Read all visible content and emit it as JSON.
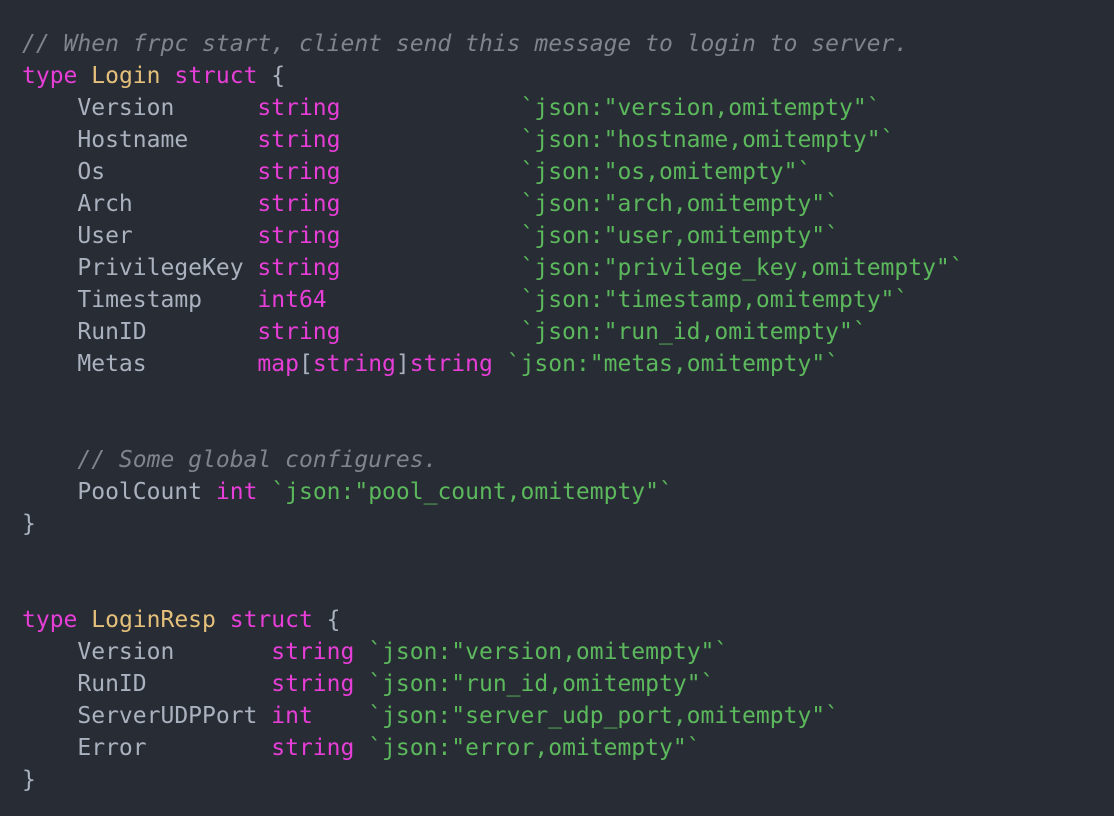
{
  "editor": {
    "language": "go",
    "background_color": "#282c34",
    "theme_colors": {
      "comment": "#7f848e",
      "keyword": "#e83ed8",
      "type_name": "#e5c07b",
      "builtin_type": "#e83ed8",
      "identifier": "#abb2bf",
      "punctuation": "#abb2bf",
      "struct_tag": "#5cb85c"
    }
  },
  "lines": [
    {
      "n": 1,
      "tokens": [
        {
          "t": "// When frpc start, client send this message to login to server.",
          "c": "comment"
        }
      ]
    },
    {
      "n": 2,
      "tokens": [
        {
          "t": "type ",
          "c": "keyword"
        },
        {
          "t": "Login",
          "c": "typename"
        },
        {
          "t": " ",
          "c": "plain"
        },
        {
          "t": "struct",
          "c": "keyword"
        },
        {
          "t": " {",
          "c": "punct"
        }
      ]
    },
    {
      "n": 3,
      "tokens": [
        {
          "t": "    Version      ",
          "c": "ident"
        },
        {
          "t": "string",
          "c": "type"
        },
        {
          "t": "             ",
          "c": "plain"
        },
        {
          "t": "`json:\"version,omitempty\"`",
          "c": "tag"
        }
      ]
    },
    {
      "n": 4,
      "tokens": [
        {
          "t": "    Hostname     ",
          "c": "ident"
        },
        {
          "t": "string",
          "c": "type"
        },
        {
          "t": "             ",
          "c": "plain"
        },
        {
          "t": "`json:\"hostname,omitempty\"`",
          "c": "tag"
        }
      ]
    },
    {
      "n": 5,
      "tokens": [
        {
          "t": "    Os           ",
          "c": "ident"
        },
        {
          "t": "string",
          "c": "type"
        },
        {
          "t": "             ",
          "c": "plain"
        },
        {
          "t": "`json:\"os,omitempty\"`",
          "c": "tag"
        }
      ]
    },
    {
      "n": 6,
      "tokens": [
        {
          "t": "    Arch         ",
          "c": "ident"
        },
        {
          "t": "string",
          "c": "type"
        },
        {
          "t": "             ",
          "c": "plain"
        },
        {
          "t": "`json:\"arch,omitempty\"`",
          "c": "tag"
        }
      ]
    },
    {
      "n": 7,
      "tokens": [
        {
          "t": "    User         ",
          "c": "ident"
        },
        {
          "t": "string",
          "c": "type"
        },
        {
          "t": "             ",
          "c": "plain"
        },
        {
          "t": "`json:\"user,omitempty\"`",
          "c": "tag"
        }
      ]
    },
    {
      "n": 8,
      "tokens": [
        {
          "t": "    PrivilegeKey ",
          "c": "ident"
        },
        {
          "t": "string",
          "c": "type"
        },
        {
          "t": "             ",
          "c": "plain"
        },
        {
          "t": "`json:\"privilege_key,omitempty\"`",
          "c": "tag"
        }
      ]
    },
    {
      "n": 9,
      "tokens": [
        {
          "t": "    Timestamp    ",
          "c": "ident"
        },
        {
          "t": "int64",
          "c": "type"
        },
        {
          "t": "              ",
          "c": "plain"
        },
        {
          "t": "`json:\"timestamp,omitempty\"`",
          "c": "tag"
        }
      ]
    },
    {
      "n": 10,
      "tokens": [
        {
          "t": "    RunID        ",
          "c": "ident"
        },
        {
          "t": "string",
          "c": "type"
        },
        {
          "t": "             ",
          "c": "plain"
        },
        {
          "t": "`json:\"run_id,omitempty\"`",
          "c": "tag"
        }
      ]
    },
    {
      "n": 11,
      "tokens": [
        {
          "t": "    Metas        ",
          "c": "ident"
        },
        {
          "t": "map",
          "c": "type"
        },
        {
          "t": "[",
          "c": "punct"
        },
        {
          "t": "string",
          "c": "type"
        },
        {
          "t": "]",
          "c": "punct"
        },
        {
          "t": "string",
          "c": "type"
        },
        {
          "t": " ",
          "c": "plain"
        },
        {
          "t": "`json:\"metas,omitempty\"`",
          "c": "tag"
        }
      ]
    },
    {
      "n": 12,
      "tokens": []
    },
    {
      "n": 13,
      "tokens": []
    },
    {
      "n": 14,
      "tokens": [
        {
          "t": "    // Some global configures.",
          "c": "comment"
        }
      ]
    },
    {
      "n": 15,
      "tokens": [
        {
          "t": "    PoolCount ",
          "c": "ident"
        },
        {
          "t": "int",
          "c": "type"
        },
        {
          "t": " ",
          "c": "plain"
        },
        {
          "t": "`json:\"pool_count,omitempty\"`",
          "c": "tag"
        }
      ]
    },
    {
      "n": 16,
      "tokens": [
        {
          "t": "}",
          "c": "punct"
        }
      ]
    },
    {
      "n": 17,
      "tokens": []
    },
    {
      "n": 18,
      "tokens": []
    },
    {
      "n": 19,
      "tokens": [
        {
          "t": "type ",
          "c": "keyword"
        },
        {
          "t": "LoginResp",
          "c": "typename"
        },
        {
          "t": " ",
          "c": "plain"
        },
        {
          "t": "struct",
          "c": "keyword"
        },
        {
          "t": " {",
          "c": "punct"
        }
      ]
    },
    {
      "n": 20,
      "tokens": [
        {
          "t": "    Version       ",
          "c": "ident"
        },
        {
          "t": "string",
          "c": "type"
        },
        {
          "t": " ",
          "c": "plain"
        },
        {
          "t": "`json:\"version,omitempty\"`",
          "c": "tag"
        }
      ]
    },
    {
      "n": 21,
      "tokens": [
        {
          "t": "    RunID         ",
          "c": "ident"
        },
        {
          "t": "string",
          "c": "type"
        },
        {
          "t": " ",
          "c": "plain"
        },
        {
          "t": "`json:\"run_id,omitempty\"`",
          "c": "tag"
        }
      ]
    },
    {
      "n": 22,
      "tokens": [
        {
          "t": "    ServerUDPPort ",
          "c": "ident"
        },
        {
          "t": "int",
          "c": "type"
        },
        {
          "t": "    ",
          "c": "plain"
        },
        {
          "t": "`json:\"server_udp_port,omitempty\"`",
          "c": "tag"
        }
      ]
    },
    {
      "n": 23,
      "tokens": [
        {
          "t": "    Error         ",
          "c": "ident"
        },
        {
          "t": "string",
          "c": "type"
        },
        {
          "t": " ",
          "c": "plain"
        },
        {
          "t": "`json:\"error,omitempty\"`",
          "c": "tag"
        }
      ]
    },
    {
      "n": 24,
      "tokens": [
        {
          "t": "}",
          "c": "punct"
        }
      ]
    }
  ]
}
